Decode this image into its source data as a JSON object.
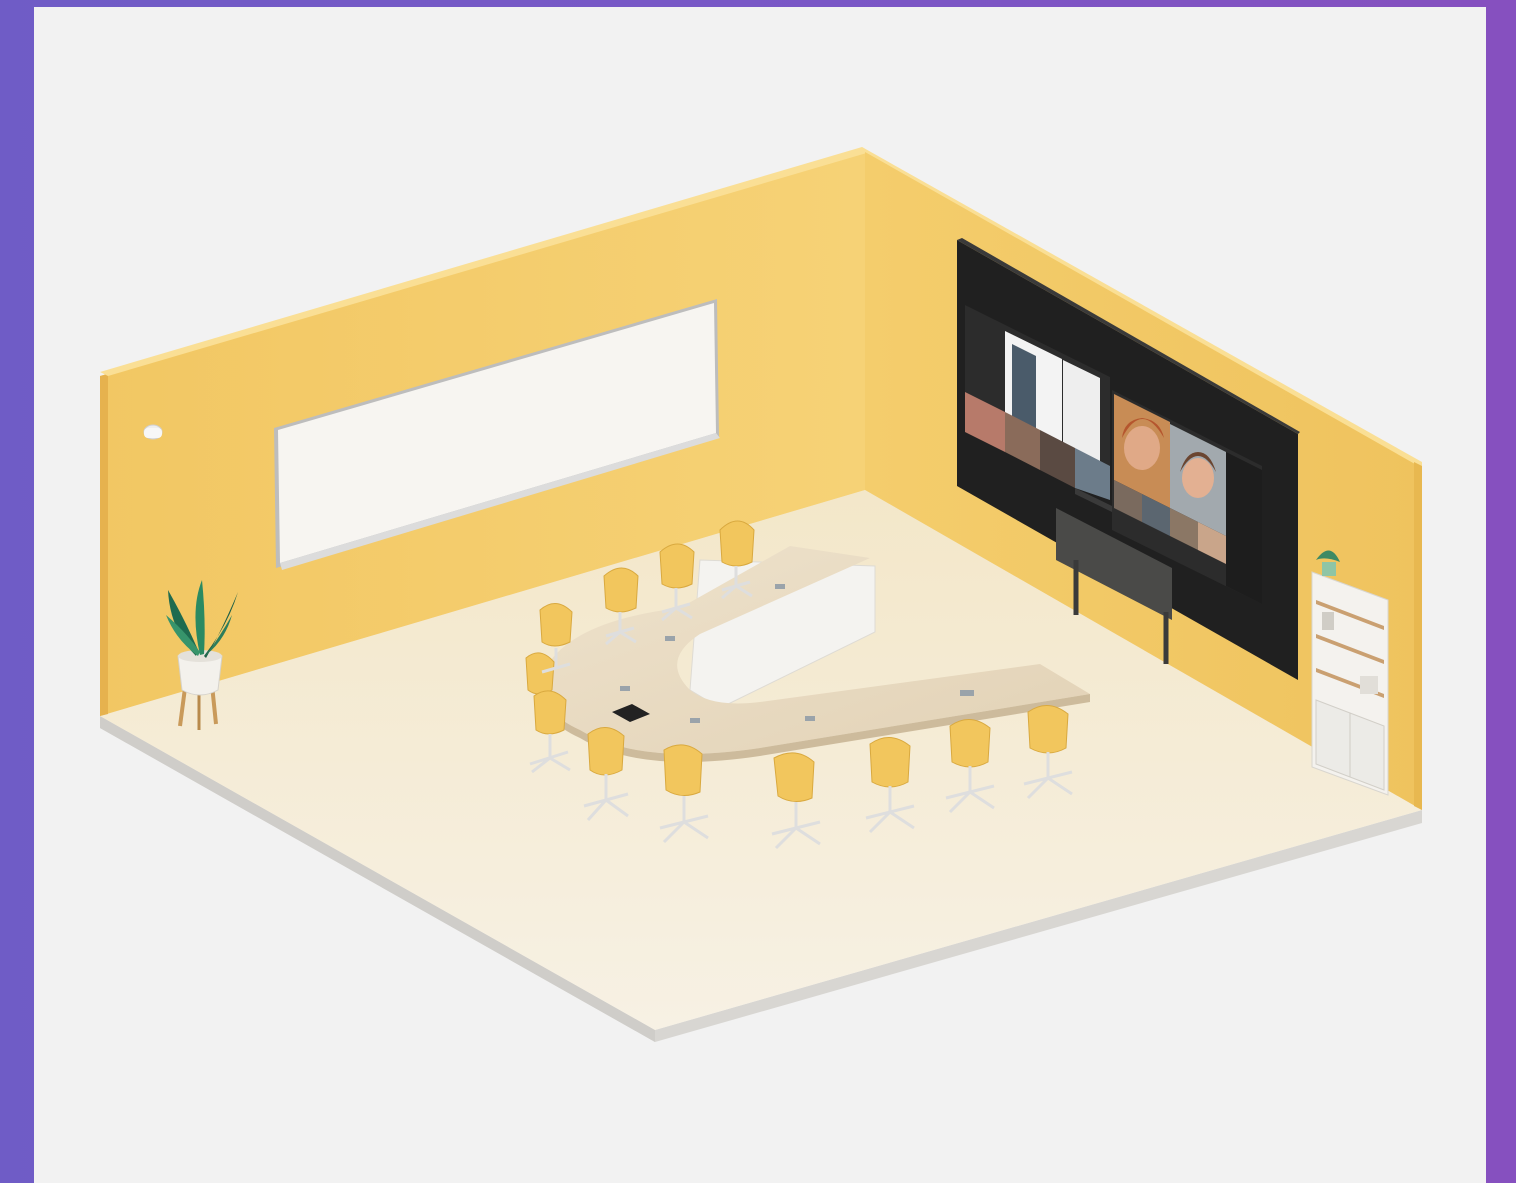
{
  "scene": {
    "colors": {
      "frame": "#7559c6",
      "card": "#f2f2f2",
      "wall": "#f5cf6b",
      "floor": "#f4ecd8",
      "chair": "#f2c65d",
      "table": "#eadcc4",
      "display": "#1e1e1e"
    }
  }
}
